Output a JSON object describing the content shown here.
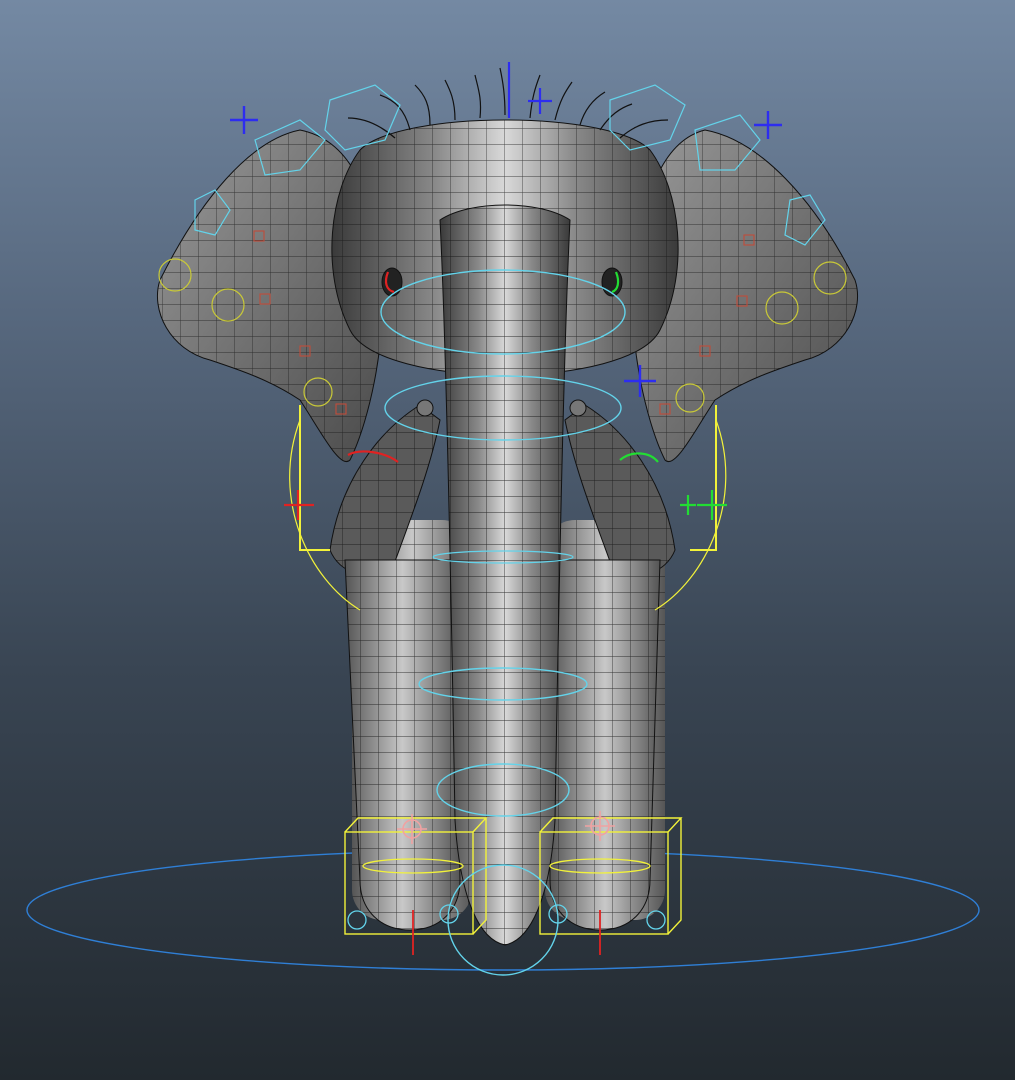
{
  "viewport": {
    "background_top": "#7489a3",
    "background_bottom": "#22292f",
    "title": ""
  },
  "model": {
    "subject": "elephant",
    "render_mode": "wireframe-on-shaded",
    "mesh_color": "#8a8a8a",
    "wire_color": "#111111"
  },
  "rig_controls": {
    "colors": {
      "cyan": "#63d3ea",
      "yellow": "#f2f23a",
      "blue": "#2d2df0",
      "red": "#e02222",
      "green": "#22dd33",
      "pink": "#f0a2a2",
      "ground_ring": "#2f7fd6",
      "ear_marker": "#c04c3a"
    },
    "items": [
      {
        "name": "ground-circle-control",
        "color": "ground_ring"
      },
      {
        "name": "head-ring-control",
        "color": "cyan"
      },
      {
        "name": "trunk-ring-control-1",
        "color": "cyan"
      },
      {
        "name": "trunk-ring-control-2",
        "color": "cyan"
      },
      {
        "name": "trunk-ring-control-3",
        "color": "cyan"
      },
      {
        "name": "trunk-ring-control-4",
        "color": "cyan"
      },
      {
        "name": "ear-control-left",
        "color": "cyan"
      },
      {
        "name": "ear-control-right",
        "color": "cyan"
      },
      {
        "name": "leg-ik-box-left",
        "color": "yellow"
      },
      {
        "name": "leg-ik-box-right",
        "color": "yellow"
      },
      {
        "name": "locator-ear-left",
        "color": "blue"
      },
      {
        "name": "locator-ear-right",
        "color": "blue"
      },
      {
        "name": "locator-head-top",
        "color": "blue"
      },
      {
        "name": "locator-eye",
        "color": "blue"
      },
      {
        "name": "locator-shoulder-left",
        "color": "red"
      },
      {
        "name": "locator-shoulder-right",
        "color": "green"
      }
    ]
  }
}
